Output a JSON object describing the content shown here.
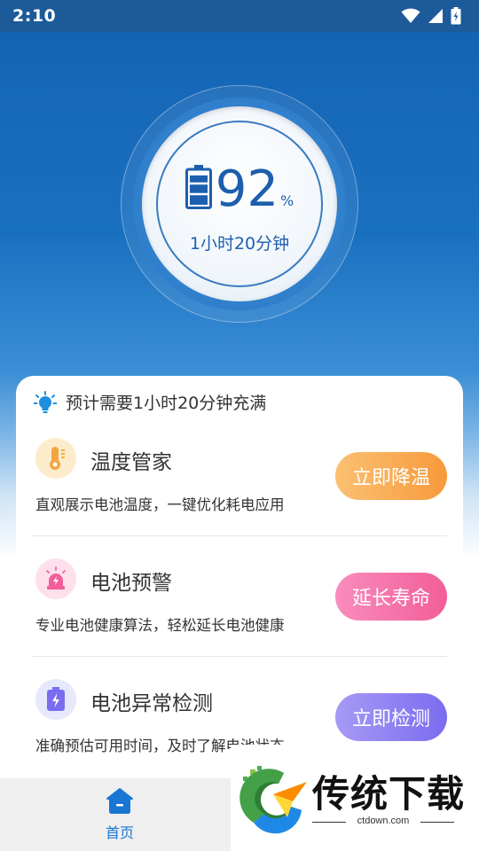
{
  "status_bar": {
    "time": "2:10",
    "icons": [
      "wifi-icon",
      "cellular-signal-icon",
      "battery-charging-icon"
    ]
  },
  "gauge": {
    "percent": "92",
    "unit": "%",
    "remaining": "1小时20分钟",
    "level": 0.92,
    "icon": "battery-icon"
  },
  "card": {
    "header": {
      "icon": "lightbulb-icon",
      "text": "预计需要1小时20分钟充满"
    },
    "features": [
      {
        "icon": "thermometer-icon",
        "title": "温度管家",
        "desc": "直观展示电池温度，一键优化耗电应用",
        "button": "立即降温",
        "icon_bg": "#fdeccc",
        "button_colors": [
          "#fbc072",
          "#f79a3b"
        ]
      },
      {
        "icon": "alarm-light-icon",
        "title": "电池预警",
        "desc": "专业电池健康算法，轻松延长电池健康",
        "button": "延长寿命",
        "icon_bg": "#fde0ec",
        "button_colors": [
          "#f98cbd",
          "#f25e98"
        ]
      },
      {
        "icon": "battery-bolt-icon",
        "title": "电池异常检测",
        "desc": "准确预估可用时间，及时了解电池状态",
        "button": "立即检测",
        "icon_bg": "#e6e8fb",
        "button_colors": [
          "#a79af5",
          "#7b6cf0"
        ]
      }
    ]
  },
  "bottom_nav": {
    "items": [
      {
        "label": "首页",
        "icon": "home-icon",
        "active": true
      }
    ]
  },
  "watermark": {
    "title": "传统下载",
    "site": "ctdown.com",
    "logo": "ctdown-logo"
  },
  "colors": {
    "primary": "#1c5a99",
    "gauge_text": "#1d5fae",
    "nav_active": "#1976d2"
  }
}
